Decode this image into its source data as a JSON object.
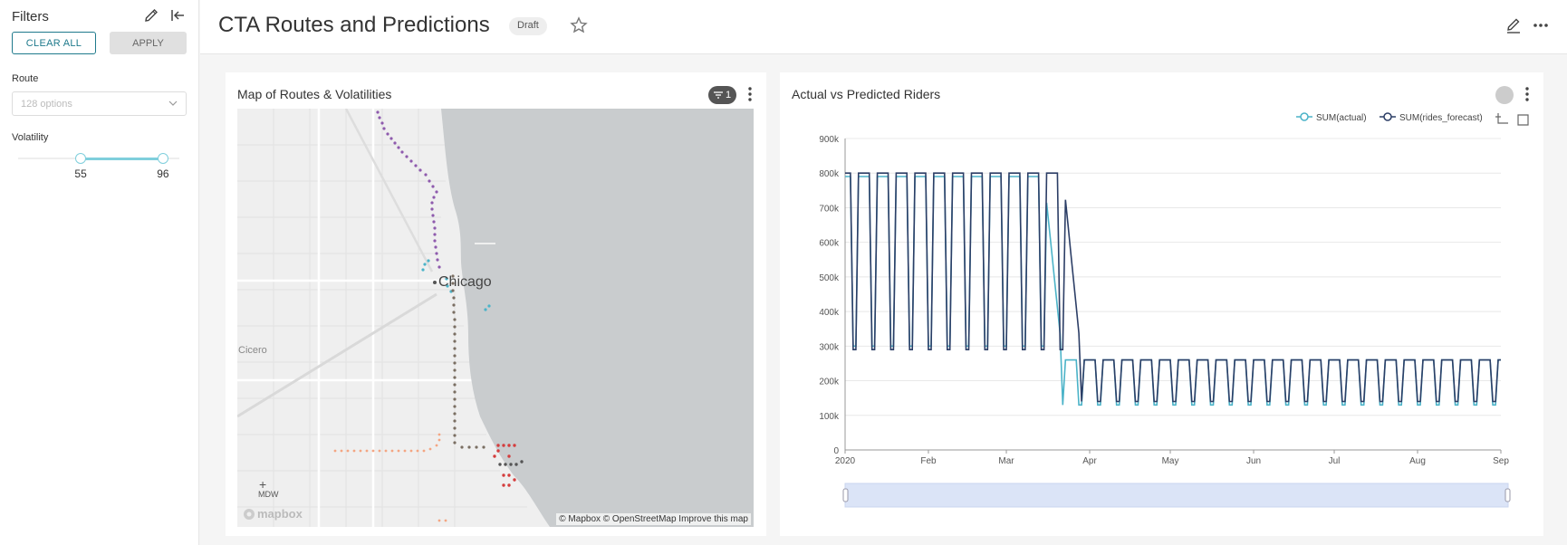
{
  "sidebar": {
    "title": "Filters",
    "clear_all_label": "CLEAR ALL",
    "apply_label": "APPLY",
    "route": {
      "label": "Route",
      "placeholder": "128 options"
    },
    "volatility": {
      "label": "Volatility",
      "min": 55,
      "max": 96,
      "min_label": "55",
      "max_label": "96",
      "range_min_fraction": 0.39,
      "range_max_fraction": 0.9
    }
  },
  "header": {
    "title": "CTA Routes and Predictions",
    "badge": "Draft"
  },
  "map_panel": {
    "title": "Map of Routes & Volatilities",
    "filter_count": "1",
    "city_label": "Chicago",
    "cicero_label": "Cicero",
    "mdw_label": "MDW",
    "logo_text": "mapbox",
    "attribution": "© Mapbox © OpenStreetMap Improve this map"
  },
  "chart_panel": {
    "title": "Actual vs Predicted Riders",
    "colors": {
      "actual": "#4bb3c8",
      "forecast": "#2c3e66"
    }
  },
  "chart_data": {
    "type": "line",
    "title": "Actual vs Predicted Riders",
    "xlabel": "",
    "ylabel": "",
    "x_tick_labels": [
      "2020",
      "Feb",
      "Mar",
      "Apr",
      "May",
      "Jun",
      "Jul",
      "Aug",
      "Sep"
    ],
    "y_tick_labels": [
      "0",
      "100k",
      "200k",
      "300k",
      "400k",
      "500k",
      "600k",
      "700k",
      "800k",
      "900k"
    ],
    "ylim": [
      0,
      900000
    ],
    "x_range": [
      "2020-01-01",
      "2020-09-01"
    ],
    "legend_position": "top-right",
    "grid": true,
    "series": [
      {
        "name": "SUM(actual)",
        "weekly_pattern": "weekday peak / weekend trough",
        "periods": [
          {
            "from": "2020-01-01",
            "to": "2020-03-15",
            "weekday": 790000,
            "weekend": 300000
          },
          {
            "from": "2020-03-22",
            "to": "2020-09-01",
            "weekday": 260000,
            "weekend": 130000
          }
        ]
      },
      {
        "name": "SUM(rides_forecast)",
        "weekly_pattern": "weekday peak / weekend trough",
        "periods": [
          {
            "from": "2020-01-01",
            "to": "2020-03-22",
            "weekday": 800000,
            "weekend": 290000
          },
          {
            "from": "2020-03-29",
            "to": "2020-09-01",
            "weekday": 260000,
            "weekend": 140000
          }
        ]
      }
    ]
  }
}
